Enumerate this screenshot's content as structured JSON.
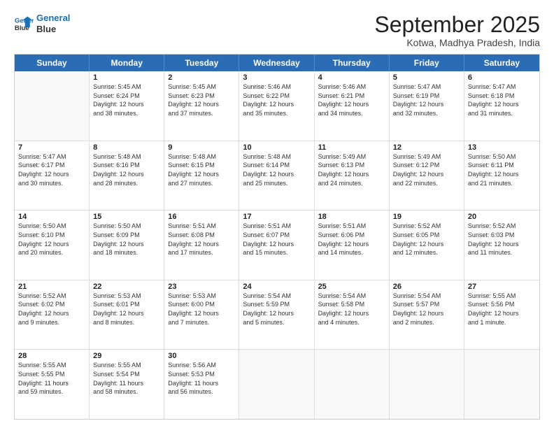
{
  "header": {
    "logo_line1": "General",
    "logo_line2": "Blue",
    "month": "September 2025",
    "location": "Kotwa, Madhya Pradesh, India"
  },
  "weekdays": [
    "Sunday",
    "Monday",
    "Tuesday",
    "Wednesday",
    "Thursday",
    "Friday",
    "Saturday"
  ],
  "rows": [
    [
      {
        "day": "",
        "info": ""
      },
      {
        "day": "1",
        "info": "Sunrise: 5:45 AM\nSunset: 6:24 PM\nDaylight: 12 hours\nand 38 minutes."
      },
      {
        "day": "2",
        "info": "Sunrise: 5:45 AM\nSunset: 6:23 PM\nDaylight: 12 hours\nand 37 minutes."
      },
      {
        "day": "3",
        "info": "Sunrise: 5:46 AM\nSunset: 6:22 PM\nDaylight: 12 hours\nand 35 minutes."
      },
      {
        "day": "4",
        "info": "Sunrise: 5:46 AM\nSunset: 6:21 PM\nDaylight: 12 hours\nand 34 minutes."
      },
      {
        "day": "5",
        "info": "Sunrise: 5:47 AM\nSunset: 6:19 PM\nDaylight: 12 hours\nand 32 minutes."
      },
      {
        "day": "6",
        "info": "Sunrise: 5:47 AM\nSunset: 6:18 PM\nDaylight: 12 hours\nand 31 minutes."
      }
    ],
    [
      {
        "day": "7",
        "info": "Sunrise: 5:47 AM\nSunset: 6:17 PM\nDaylight: 12 hours\nand 30 minutes."
      },
      {
        "day": "8",
        "info": "Sunrise: 5:48 AM\nSunset: 6:16 PM\nDaylight: 12 hours\nand 28 minutes."
      },
      {
        "day": "9",
        "info": "Sunrise: 5:48 AM\nSunset: 6:15 PM\nDaylight: 12 hours\nand 27 minutes."
      },
      {
        "day": "10",
        "info": "Sunrise: 5:48 AM\nSunset: 6:14 PM\nDaylight: 12 hours\nand 25 minutes."
      },
      {
        "day": "11",
        "info": "Sunrise: 5:49 AM\nSunset: 6:13 PM\nDaylight: 12 hours\nand 24 minutes."
      },
      {
        "day": "12",
        "info": "Sunrise: 5:49 AM\nSunset: 6:12 PM\nDaylight: 12 hours\nand 22 minutes."
      },
      {
        "day": "13",
        "info": "Sunrise: 5:50 AM\nSunset: 6:11 PM\nDaylight: 12 hours\nand 21 minutes."
      }
    ],
    [
      {
        "day": "14",
        "info": "Sunrise: 5:50 AM\nSunset: 6:10 PM\nDaylight: 12 hours\nand 20 minutes."
      },
      {
        "day": "15",
        "info": "Sunrise: 5:50 AM\nSunset: 6:09 PM\nDaylight: 12 hours\nand 18 minutes."
      },
      {
        "day": "16",
        "info": "Sunrise: 5:51 AM\nSunset: 6:08 PM\nDaylight: 12 hours\nand 17 minutes."
      },
      {
        "day": "17",
        "info": "Sunrise: 5:51 AM\nSunset: 6:07 PM\nDaylight: 12 hours\nand 15 minutes."
      },
      {
        "day": "18",
        "info": "Sunrise: 5:51 AM\nSunset: 6:06 PM\nDaylight: 12 hours\nand 14 minutes."
      },
      {
        "day": "19",
        "info": "Sunrise: 5:52 AM\nSunset: 6:05 PM\nDaylight: 12 hours\nand 12 minutes."
      },
      {
        "day": "20",
        "info": "Sunrise: 5:52 AM\nSunset: 6:03 PM\nDaylight: 12 hours\nand 11 minutes."
      }
    ],
    [
      {
        "day": "21",
        "info": "Sunrise: 5:52 AM\nSunset: 6:02 PM\nDaylight: 12 hours\nand 9 minutes."
      },
      {
        "day": "22",
        "info": "Sunrise: 5:53 AM\nSunset: 6:01 PM\nDaylight: 12 hours\nand 8 minutes."
      },
      {
        "day": "23",
        "info": "Sunrise: 5:53 AM\nSunset: 6:00 PM\nDaylight: 12 hours\nand 7 minutes."
      },
      {
        "day": "24",
        "info": "Sunrise: 5:54 AM\nSunset: 5:59 PM\nDaylight: 12 hours\nand 5 minutes."
      },
      {
        "day": "25",
        "info": "Sunrise: 5:54 AM\nSunset: 5:58 PM\nDaylight: 12 hours\nand 4 minutes."
      },
      {
        "day": "26",
        "info": "Sunrise: 5:54 AM\nSunset: 5:57 PM\nDaylight: 12 hours\nand 2 minutes."
      },
      {
        "day": "27",
        "info": "Sunrise: 5:55 AM\nSunset: 5:56 PM\nDaylight: 12 hours\nand 1 minute."
      }
    ],
    [
      {
        "day": "28",
        "info": "Sunrise: 5:55 AM\nSunset: 5:55 PM\nDaylight: 11 hours\nand 59 minutes."
      },
      {
        "day": "29",
        "info": "Sunrise: 5:55 AM\nSunset: 5:54 PM\nDaylight: 11 hours\nand 58 minutes."
      },
      {
        "day": "30",
        "info": "Sunrise: 5:56 AM\nSunset: 5:53 PM\nDaylight: 11 hours\nand 56 minutes."
      },
      {
        "day": "",
        "info": ""
      },
      {
        "day": "",
        "info": ""
      },
      {
        "day": "",
        "info": ""
      },
      {
        "day": "",
        "info": ""
      }
    ]
  ]
}
